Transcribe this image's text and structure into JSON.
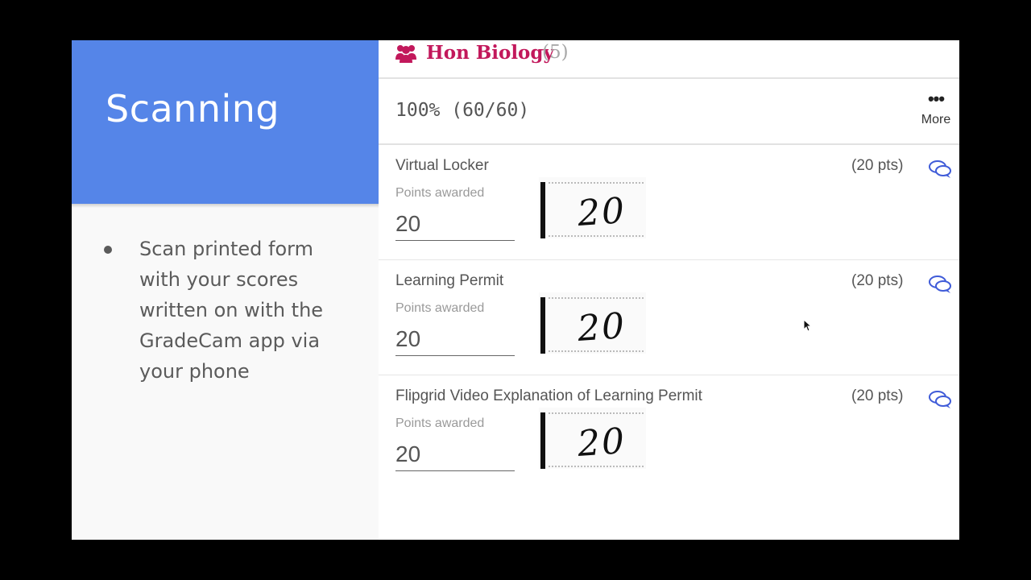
{
  "slide": {
    "title": "Scanning",
    "bullets": [
      "Scan printed form with your scores written on with the GradeCam app via your phone"
    ]
  },
  "panel": {
    "class_icon": "group-icon",
    "class_name": "Hon Biology",
    "class_count": "(5)",
    "score_summary": "100% (60/60)",
    "more_icon": "ellipsis-icon",
    "more_label": "More",
    "colors": {
      "class_name": "#c2185b",
      "accent": "#5585e8",
      "comment_icon": "#3f5bd8"
    },
    "items": [
      {
        "title": "Virtual Locker",
        "points_possible": "(20 pts)",
        "points_label": "Points awarded",
        "points_value": "20",
        "scan_text": "20",
        "comment_icon": "comment-icon"
      },
      {
        "title": "Learning Permit",
        "points_possible": "(20 pts)",
        "points_label": "Points awarded",
        "points_value": "20",
        "scan_text": "20",
        "comment_icon": "comment-icon"
      },
      {
        "title": "Flipgrid Video Explanation of Learning Permit",
        "points_possible": "(20 pts)",
        "points_label": "Points awarded",
        "points_value": "20",
        "scan_text": "20",
        "comment_icon": "comment-icon"
      }
    ]
  }
}
